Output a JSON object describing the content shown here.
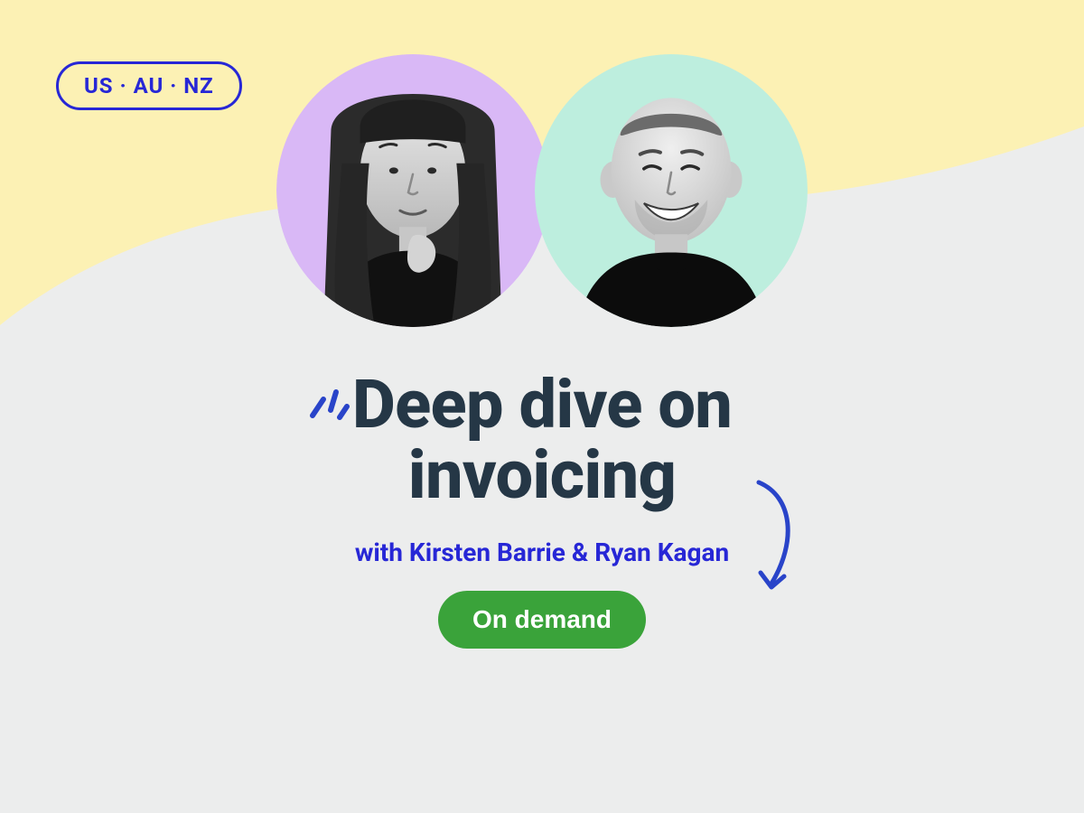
{
  "regions_label": "US · AU · NZ",
  "title_line1": "Deep dive on",
  "title_line2": "invoicing",
  "subtitle": "with Kirsten Barrie & Ryan Kagan",
  "cta_label": "On demand",
  "colors": {
    "cream": "#fcf1b4",
    "gray": "#eceded",
    "lavender": "#d9b8f6",
    "mint": "#bdeede",
    "blue": "#2727d6",
    "slate": "#253746",
    "green": "#3aa33a"
  },
  "avatars": [
    {
      "name": "Kirsten Barrie",
      "bg": "lavender"
    },
    {
      "name": "Ryan Kagan",
      "bg": "mint"
    }
  ]
}
